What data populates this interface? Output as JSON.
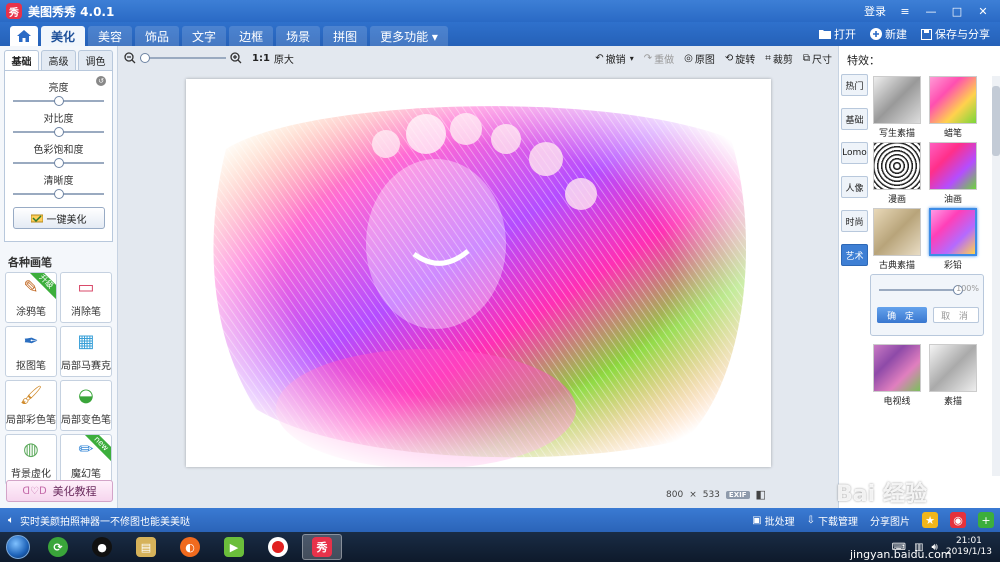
{
  "titlebar": {
    "logo_text": "秀",
    "title": "美图秀秀 4.0.1",
    "login": "登录",
    "minimize": "—",
    "maximize": "□",
    "close": "✕",
    "menu": "≡"
  },
  "menu": {
    "tabs": [
      {
        "label": "美化",
        "active": true
      },
      {
        "label": "美容",
        "active": false
      },
      {
        "label": "饰品",
        "active": false
      },
      {
        "label": "文字",
        "active": false
      },
      {
        "label": "边框",
        "active": false
      },
      {
        "label": "场景",
        "active": false
      },
      {
        "label": "拼图",
        "active": false
      },
      {
        "label": "更多功能 ▾",
        "active": false
      }
    ],
    "open": "打开",
    "new": "新建",
    "save_share": "保存与分享"
  },
  "left_panel": {
    "subtabs": [
      "基础",
      "高级",
      "调色"
    ],
    "adjustments": [
      {
        "label": "亮度",
        "level": 0.5
      },
      {
        "label": "对比度",
        "level": 0.5
      },
      {
        "label": "色彩饱和度",
        "level": 0.5
      },
      {
        "label": "清晰度",
        "level": 0.5
      }
    ],
    "one_key_beautify": "一键美化",
    "brushes_title": "各种画笔",
    "brushes": [
      {
        "label": "涂鸦笔",
        "ribbon": "升级",
        "icon": "crayon-icon"
      },
      {
        "label": "消除笔",
        "ribbon": "",
        "icon": "eraser-icon"
      },
      {
        "label": "抠图笔",
        "ribbon": "",
        "icon": "cutout-pen-icon"
      },
      {
        "label": "局部马赛克",
        "ribbon": "",
        "icon": "mosaic-icon"
      },
      {
        "label": "局部彩色笔",
        "ribbon": "",
        "icon": "color-brush-icon"
      },
      {
        "label": "局部变色笔",
        "ribbon": "",
        "icon": "color-change-bucket-icon"
      },
      {
        "label": "背景虚化",
        "ribbon": "",
        "icon": "background-blur-icon"
      },
      {
        "label": "魔幻笔",
        "ribbon": "new",
        "icon": "magic-pen-icon"
      }
    ],
    "tutorial": "美化教程"
  },
  "toolbar": {
    "zoom_level": 0,
    "one_to_one": "1:1",
    "original_size": "原大",
    "undo": "撤销",
    "redo": "重做",
    "original": "原图",
    "rotate": "旋转",
    "crop": "裁剪",
    "size": "尺寸"
  },
  "image_info": {
    "width": "800",
    "times": "×",
    "height": "533",
    "exif": "EXIF"
  },
  "right_panel": {
    "title": "特效：",
    "categories": [
      {
        "label": "热门",
        "active": false
      },
      {
        "label": "基础",
        "active": false
      },
      {
        "label": "Lomo",
        "active": false
      },
      {
        "label": "人像",
        "active": false
      },
      {
        "label": "时尚",
        "active": false
      },
      {
        "label": "艺术",
        "active": true
      }
    ],
    "effects": [
      {
        "label": "写生素描",
        "selected": false
      },
      {
        "label": "蜡笔",
        "selected": false
      },
      {
        "label": "漫画",
        "selected": false
      },
      {
        "label": "油画",
        "selected": false
      },
      {
        "label": "古典素描",
        "selected": false
      },
      {
        "label": "彩铅",
        "selected": true
      },
      {
        "label": "电视线",
        "selected": false
      },
      {
        "label": "素描",
        "selected": false
      }
    ],
    "intensity_percent": "100%",
    "intensity_level": 1.0,
    "confirm": "确 定",
    "cancel": "取 消"
  },
  "statusbar": {
    "promo": "实时美颜拍照神器一不修图也能美美哒",
    "batch": "批处理",
    "download": "下载管理",
    "share": "分享图片"
  },
  "taskbar": {
    "time": "21:01",
    "date": "2019/1/13",
    "app_active_text": "秀"
  },
  "watermark": {
    "logo": "Bai 经验",
    "url": "jingyan.baidu.com"
  },
  "colors": {
    "brand_blue": "#2a6ac5",
    "accent_pink": "#e8324a",
    "selection_blue": "#3d8ce6"
  }
}
